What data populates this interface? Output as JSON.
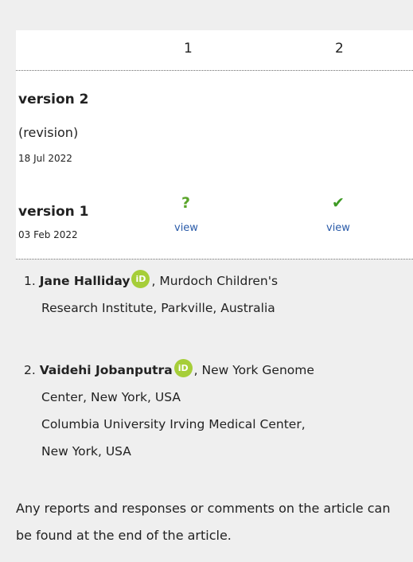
{
  "table": {
    "columns": [
      "1",
      "2"
    ]
  },
  "versions": [
    {
      "title": "version 2",
      "note": "(revision)",
      "date": "18 Jul 2022"
    },
    {
      "title": "version 1",
      "date": "03 Feb 2022",
      "reviews": [
        {
          "icon": "question-icon",
          "glyph": "?",
          "link": "view"
        },
        {
          "icon": "check-icon",
          "glyph": "✔",
          "link": "view"
        }
      ]
    }
  ],
  "reviewers": [
    {
      "num": "1.",
      "name": "Jane Halliday",
      "orcid_badge": "iD",
      "affiliation_line1": ", Murdoch Children's",
      "affiliation_line2": "Research Institute, Parkville, Australia"
    },
    {
      "num": "2.",
      "name": "Vaidehi Jobanputra",
      "orcid_badge": "iD",
      "affiliation_line1": ", New York Genome",
      "affiliation_line2": "Center, New York, USA",
      "affiliation_line3": "Columbia University Irving Medical Center,",
      "affiliation_line4": "New York, USA"
    }
  ],
  "footer_note": "Any reports and responses or comments on the article can be found at the end of the article.",
  "colors": {
    "panel_bg": "#efefef",
    "card_bg": "#ffffff",
    "link": "#2a5ba9",
    "orcid_green": "#a6ce39",
    "status_green": "#3e9a24"
  }
}
